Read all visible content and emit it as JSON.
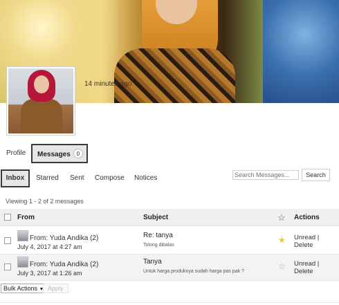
{
  "header": {
    "last_active": "14 minutes ago"
  },
  "tabs": {
    "profile": "Profile",
    "messages": "Messages",
    "messages_count": "0"
  },
  "subnav": {
    "inbox": "Inbox",
    "starred": "Starred",
    "sent": "Sent",
    "compose": "Compose",
    "notices": "Notices"
  },
  "search": {
    "placeholder": "Search Messages...",
    "button": "Search"
  },
  "listing": {
    "viewing": "Viewing 1 - 2 of 2 messages"
  },
  "table": {
    "col_from": "From",
    "col_subject": "Subject",
    "col_actions": "Actions",
    "rows": [
      {
        "from": "From: Yuda Andika (2)",
        "date": "July 4, 2017 at 4:27 am",
        "subject": "Re: tanya",
        "excerpt": "Tolong dibalas",
        "starred": true,
        "action_unread": "Unread |",
        "action_delete": "Delete"
      },
      {
        "from": "From: Yuda Andika (2)",
        "date": "July 3, 2017 at 1:26 am",
        "subject": "Tanya",
        "excerpt": "Untuk harga produknya sudah harga pas pak ?",
        "starred": false,
        "action_unread": "Unread |",
        "action_delete": "Delete"
      }
    ]
  },
  "bulk": {
    "select_label": "Bulk Actions",
    "apply": "Apply"
  },
  "colors": {
    "star_on": "#f2c12e",
    "star_off": "#aaaaaa",
    "tab_active_bg": "#e6e6e6"
  },
  "icons": {
    "star_header": "star-outline-icon",
    "star_on": "star-filled-icon",
    "star_off": "star-outline-icon",
    "dropdown": "caret-down-icon"
  }
}
